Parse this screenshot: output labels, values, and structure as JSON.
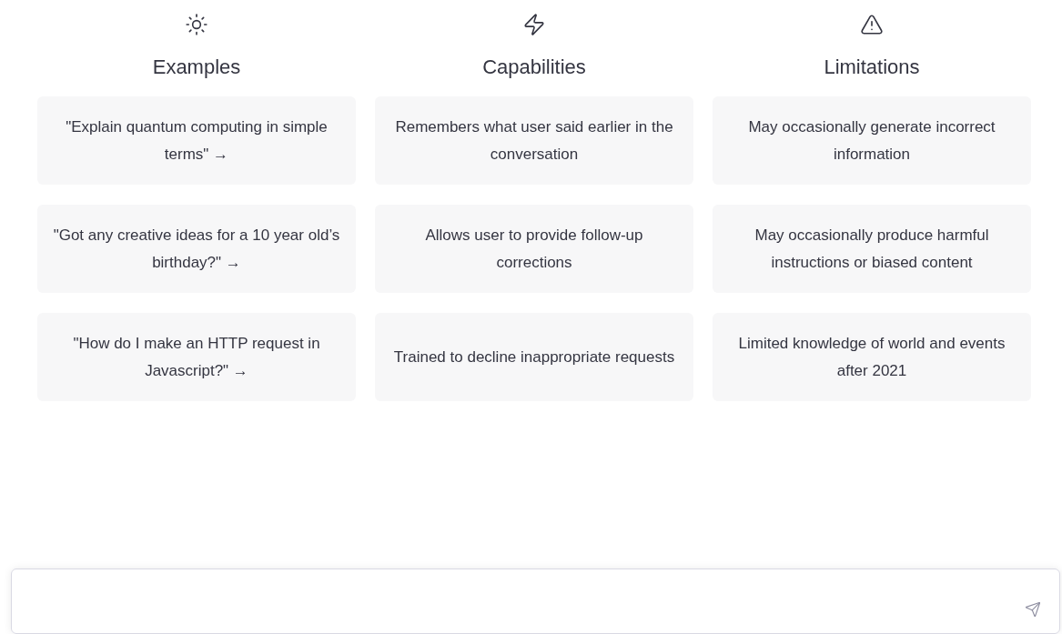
{
  "columns": [
    {
      "kind": "examples",
      "heading": "Examples",
      "cards": [
        "\"Explain quantum computing in simple terms\" →",
        "\"Got any creative ideas for a 10 year old’s birthday?\" →",
        "\"How do I make an HTTP request in Javascript?\" →"
      ]
    },
    {
      "kind": "capabilities",
      "heading": "Capabilities",
      "cards": [
        "Remembers what user said earlier in the conversation",
        "Allows user to provide follow-up corrections",
        "Trained to decline inappropriate requests"
      ]
    },
    {
      "kind": "limitations",
      "heading": "Limitations",
      "cards": [
        "May occasionally generate incorrect information",
        "May occasionally produce harmful instructions or biased content",
        "Limited knowledge of world and events after 2021"
      ]
    }
  ]
}
